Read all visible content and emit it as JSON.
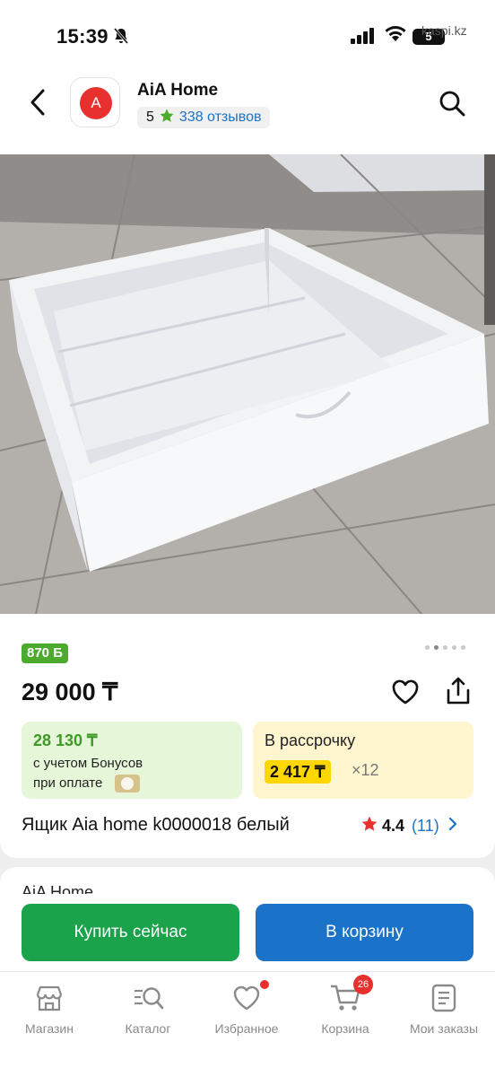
{
  "status_bar": {
    "time": "15:39",
    "watermark": "kaspi.kz",
    "battery": "5"
  },
  "header": {
    "logo_letter": "A",
    "shop_name": "AiA Home",
    "shop_rating": "5",
    "reviews": "338 отзывов"
  },
  "product": {
    "bonus_badge": "870 Б",
    "price": "29 000 ₸",
    "bonus_price": "28 130 ₸",
    "bonus_line1": "с учетом Бонусов",
    "bonus_line2": "при оплате",
    "installment_label": "В рассрочку",
    "installment_price": "2 417 ₸",
    "installment_months": "×12",
    "title": "Ящик Aia home k0000018 белый",
    "rating": "4.4",
    "rating_count": "(11)",
    "image_pages": 5,
    "active_page": 1
  },
  "seller_section": {
    "seller_name": "AiA Home"
  },
  "actions": {
    "buy_now": "Купить сейчас",
    "add_to_cart": "В корзину"
  },
  "nav": {
    "items": [
      {
        "label": "Магазин",
        "icon": "shop-icon"
      },
      {
        "label": "Каталог",
        "icon": "catalog-search-icon"
      },
      {
        "label": "Избранное",
        "icon": "heart-icon"
      },
      {
        "label": "Корзина",
        "icon": "cart-icon",
        "badge": "26"
      },
      {
        "label": "Мои заказы",
        "icon": "orders-icon"
      }
    ]
  },
  "colors": {
    "green": "#1aa34a",
    "blue": "#1a73c8",
    "red": "#e8302f",
    "bonus_green": "#4cab2f",
    "yellow": "#ffd700"
  }
}
